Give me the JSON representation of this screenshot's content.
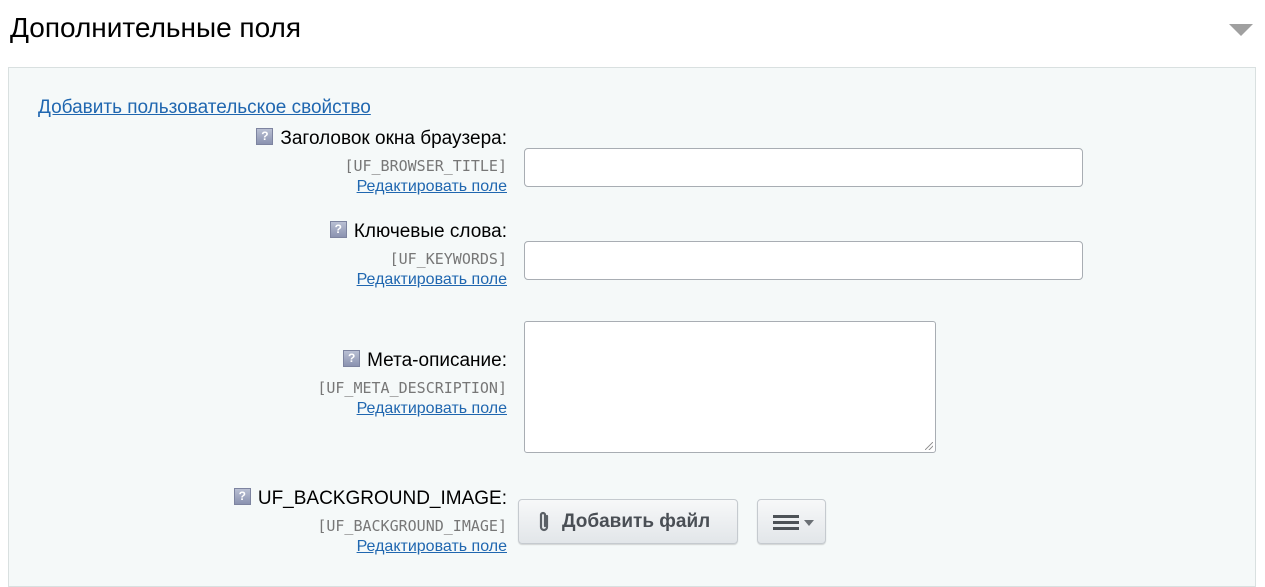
{
  "header": {
    "title": "Дополнительные поля"
  },
  "panel": {
    "add_property_link": "Добавить пользовательское свойство",
    "fields": [
      {
        "label": "Заголовок окна браузера:",
        "code": "[UF_BROWSER_TITLE]",
        "edit_link": "Редактировать поле",
        "input_value": ""
      },
      {
        "label": "Ключевые слова:",
        "code": "[UF_KEYWORDS]",
        "edit_link": "Редактировать поле",
        "input_value": ""
      },
      {
        "label": "Мета-описание:",
        "code": "[UF_META_DESCRIPTION]",
        "edit_link": "Редактировать поле",
        "input_value": ""
      },
      {
        "label": "UF_BACKGROUND_IMAGE:",
        "code": "[UF_BACKGROUND_IMAGE]",
        "edit_link": "Редактировать поле",
        "add_file_label": "Добавить файл"
      }
    ]
  },
  "icons": {
    "help": "help-icon",
    "collapse": "triangle-down-icon",
    "attach": "paperclip-icon",
    "menu": "hamburger-menu-icon"
  },
  "colors": {
    "link": "#2067b0",
    "panel_bg": "#f5f9f9",
    "help_icon": "#9aa1bd"
  }
}
